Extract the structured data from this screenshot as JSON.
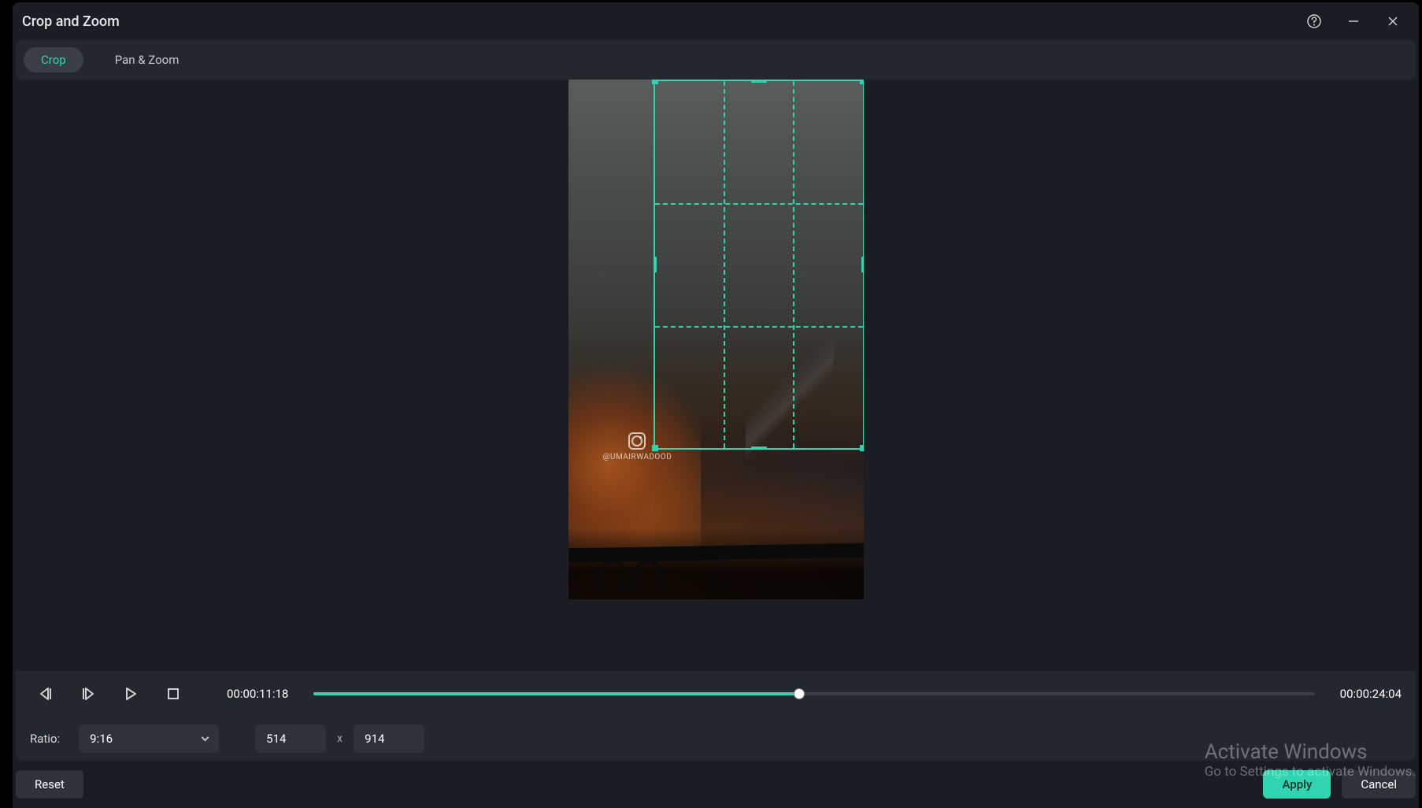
{
  "title": "Crop and Zoom",
  "tabs": {
    "crop": "Crop",
    "panzoom": "Pan & Zoom"
  },
  "watermark": "@UMAIRWADOOD",
  "playback": {
    "current": "00:00:11:18",
    "duration": "00:00:24:04"
  },
  "ratio": {
    "label": "Ratio:",
    "value": "9:16"
  },
  "dims": {
    "w": "514",
    "h": "914",
    "sep": "x"
  },
  "buttons": {
    "reset": "Reset",
    "apply": "Apply",
    "cancel": "Cancel"
  },
  "activate": {
    "line1": "Activate Windows",
    "line2": "Go to Settings to activate Windows."
  },
  "icons": {
    "help": "help-icon",
    "min": "minimize-icon",
    "close": "close-icon",
    "prev": "prev-frame-icon",
    "next": "next-frame-icon",
    "play": "play-icon",
    "stop": "stop-icon",
    "chevdown": "chevron-down-icon"
  }
}
